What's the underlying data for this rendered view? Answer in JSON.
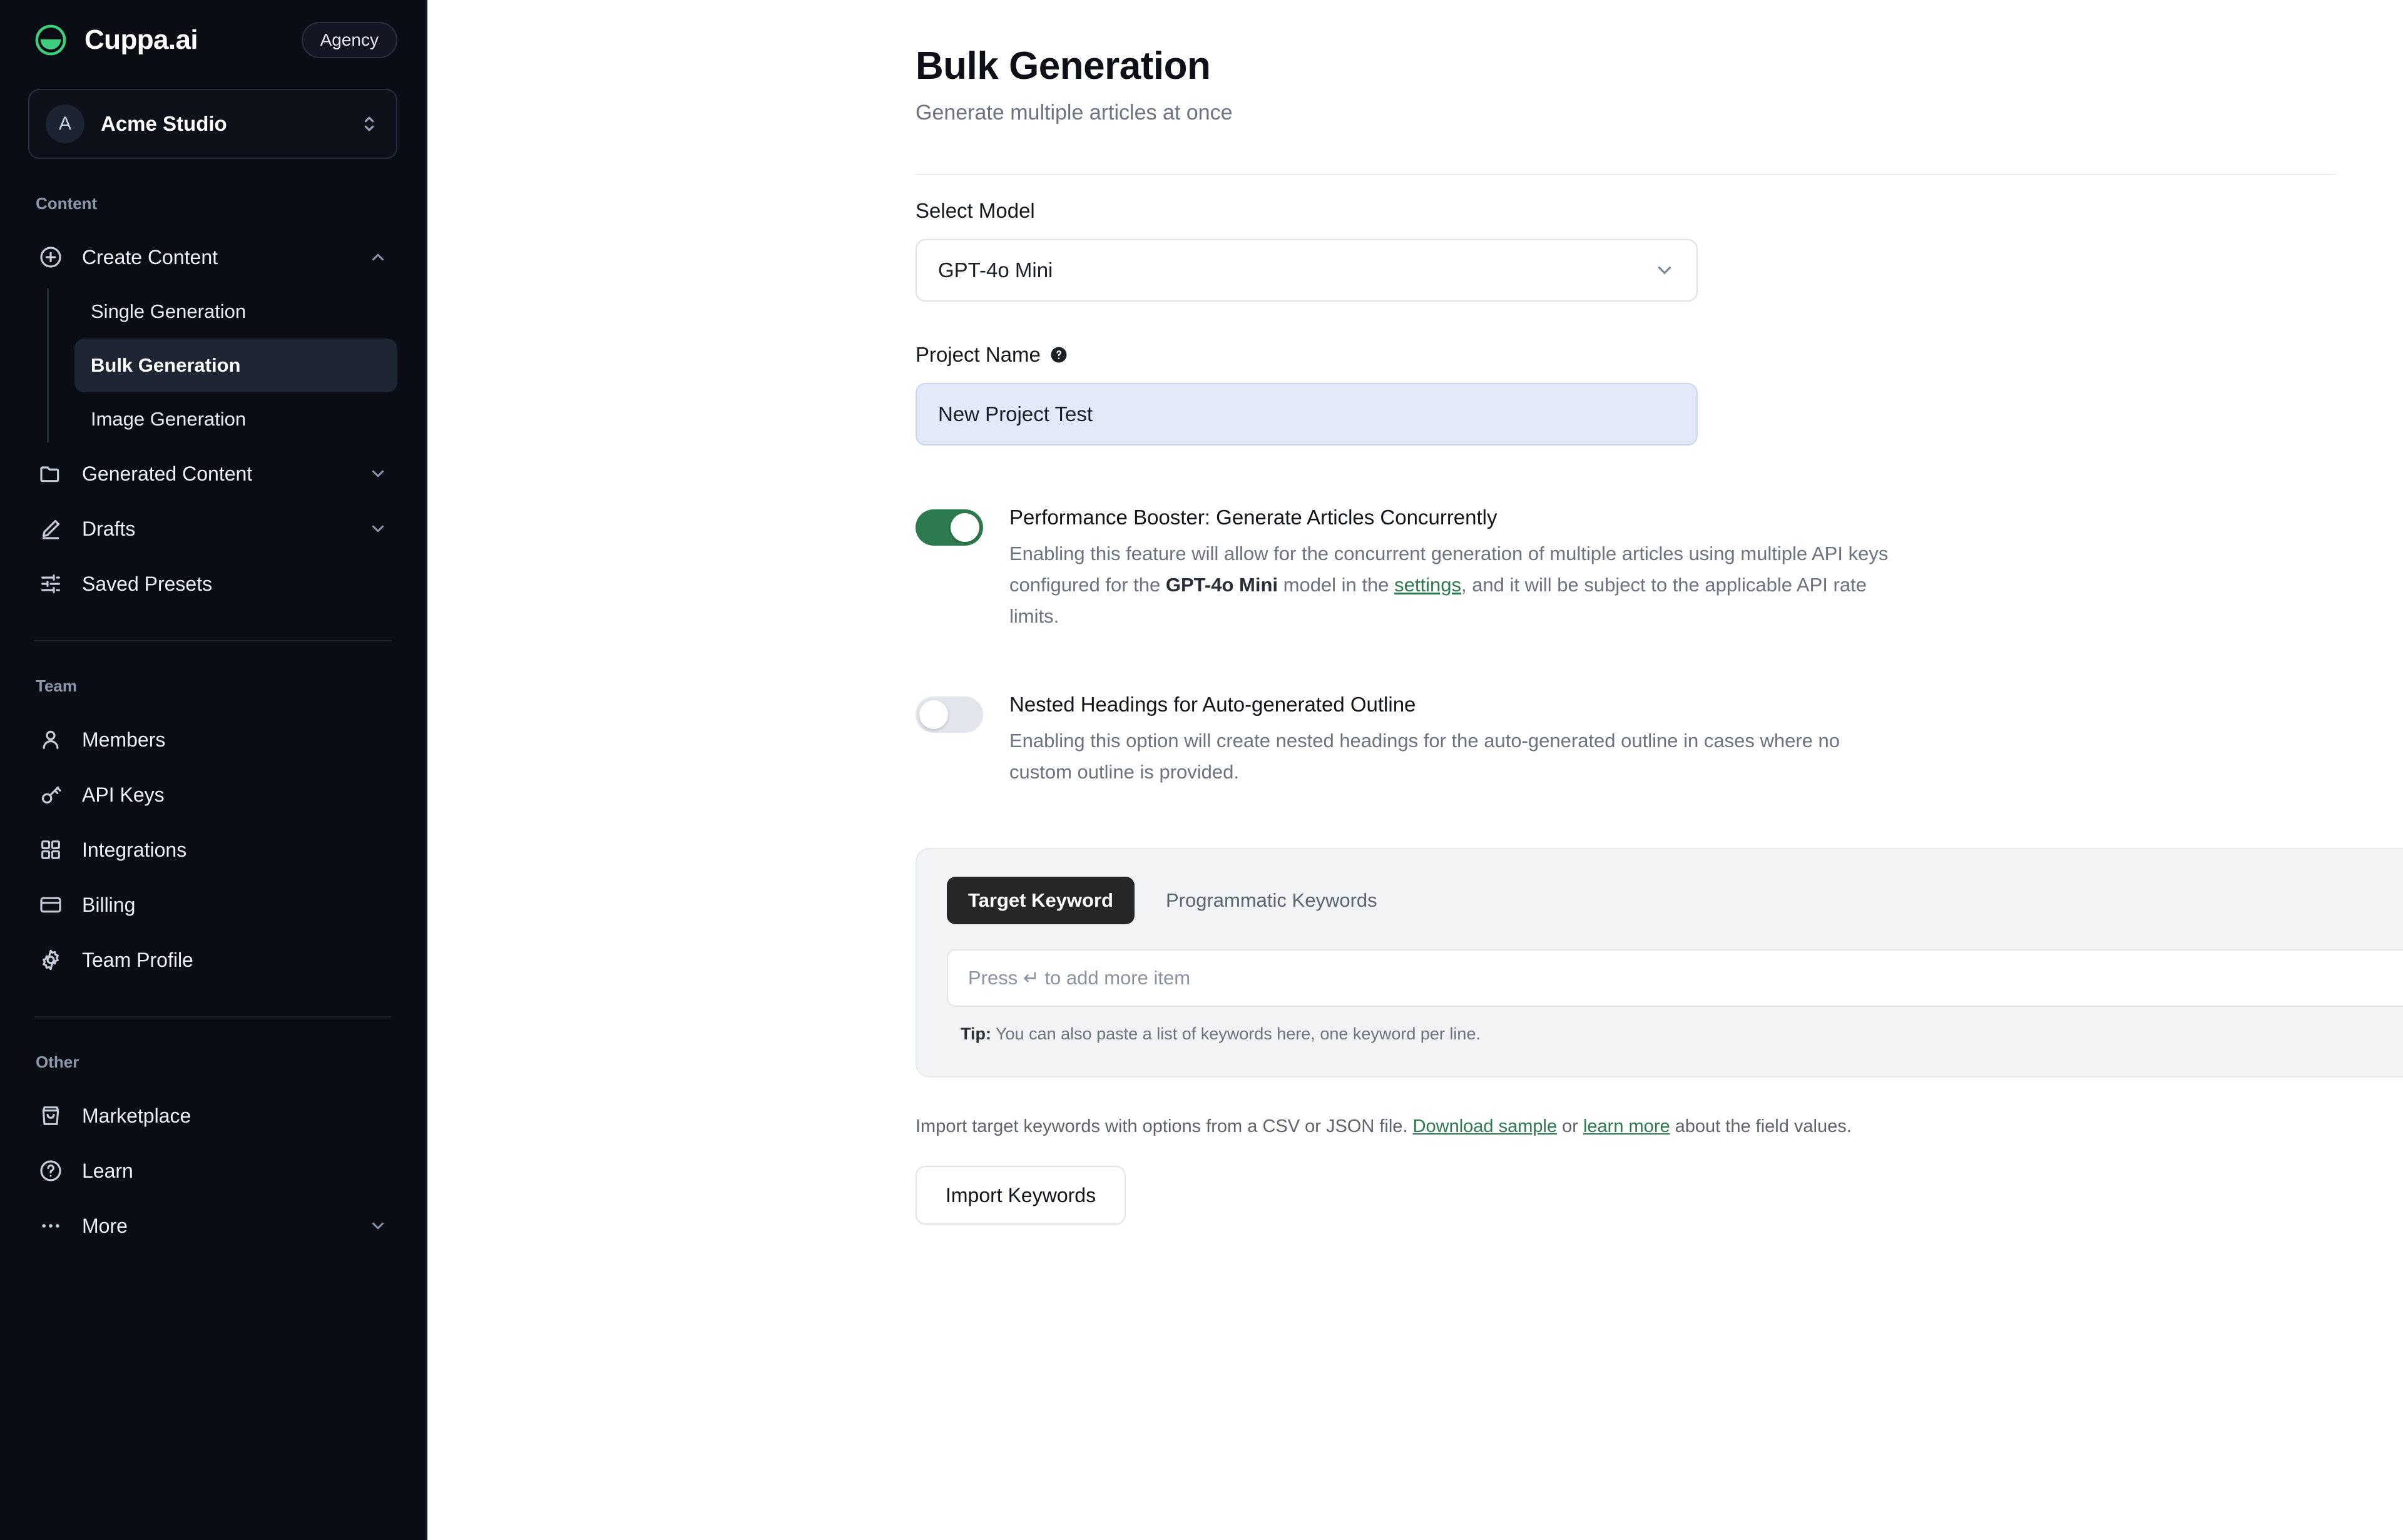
{
  "sidebar": {
    "brand": {
      "name": "Cuppa.ai",
      "badge": "Agency",
      "logo_icon": "cup-logo-icon"
    },
    "workspace": {
      "initial": "A",
      "name": "Acme Studio"
    },
    "sections": [
      {
        "label": "Content",
        "items": [
          {
            "label": "Create Content",
            "icon": "plus-circle-icon",
            "expanded": true,
            "children": [
              {
                "label": "Single Generation",
                "active": false
              },
              {
                "label": "Bulk Generation",
                "active": true
              },
              {
                "label": "Image Generation",
                "active": false
              }
            ]
          },
          {
            "label": "Generated Content",
            "icon": "folder-icon",
            "expanded": false
          },
          {
            "label": "Drafts",
            "icon": "pencil-icon",
            "expanded": false
          },
          {
            "label": "Saved Presets",
            "icon": "sliders-icon"
          }
        ]
      },
      {
        "label": "Team",
        "items": [
          {
            "label": "Members",
            "icon": "user-icon"
          },
          {
            "label": "API Keys",
            "icon": "key-icon"
          },
          {
            "label": "Integrations",
            "icon": "grid-icon"
          },
          {
            "label": "Billing",
            "icon": "credit-card-icon"
          },
          {
            "label": "Team Profile",
            "icon": "gear-icon"
          }
        ]
      },
      {
        "label": "Other",
        "items": [
          {
            "label": "Marketplace",
            "icon": "shopping-bag-icon"
          },
          {
            "label": "Learn",
            "icon": "question-circle-icon"
          },
          {
            "label": "More",
            "icon": "ellipsis-icon",
            "expanded": false
          }
        ]
      }
    ]
  },
  "header": {
    "title": "Bulk Generation",
    "subtitle": "Generate multiple articles at once",
    "menu_icon": "hamburger-menu-icon"
  },
  "form": {
    "model_label": "Select Model",
    "model_value": "GPT-4o Mini",
    "project_label": "Project Name",
    "project_value": "New Project Test",
    "project_help_icon": "help-circle-icon"
  },
  "toggles": [
    {
      "title": "Performance Booster: Generate Articles Concurrently",
      "state": "on",
      "desc_part1": "Enabling this feature will allow for the concurrent generation of multiple articles using multiple API keys configured for the ",
      "desc_bold": "GPT-4o Mini",
      "desc_part2": " model in the ",
      "desc_link": "settings",
      "desc_part3": ", and it will be subject to the applicable API rate limits."
    },
    {
      "title": "Nested Headings for Auto-generated Outline",
      "state": "off",
      "desc": "Enabling this option will create nested headings for the auto-generated outline in cases where no custom outline is provided."
    }
  ],
  "keywords": {
    "tabs": [
      {
        "label": "Target Keyword",
        "active": true
      },
      {
        "label": "Programmatic Keywords",
        "active": false
      }
    ],
    "input_placeholder": "Press ↵ to add more item",
    "add_icon": "plus-icon",
    "tip_label": "Tip:",
    "tip_text": " You can also paste a list of keywords here, one keyword per line."
  },
  "import": {
    "text_part1": "Import target keywords with options from a CSV or JSON file. ",
    "link1": "Download sample",
    "text_part2": " or ",
    "link2": "learn more",
    "text_part3": " about the field values.",
    "button_label": "Import Keywords"
  },
  "colors": {
    "accent_green": "#2d7a4e",
    "sidebar_bg": "#0a0d14",
    "dark_pill": "#262626"
  }
}
